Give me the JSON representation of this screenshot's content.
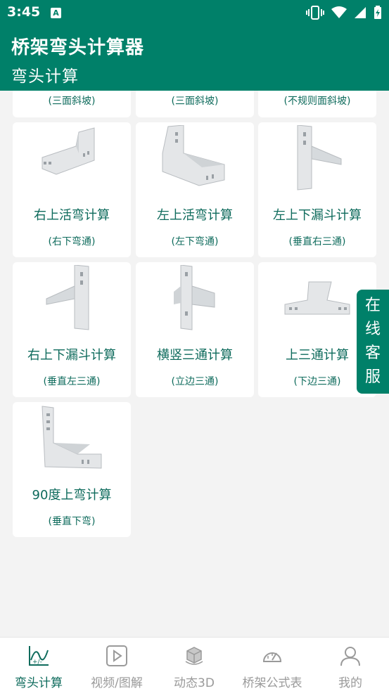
{
  "status": {
    "time": "3:45",
    "a_badge": "A"
  },
  "appbar": {
    "title": "桥架弯头计算器",
    "subtitle": "弯头计算"
  },
  "top_cards": [
    {
      "sub": "(三面斜坡)"
    },
    {
      "sub": "(三面斜坡)"
    },
    {
      "sub": "(不规则面斜坡)"
    }
  ],
  "cards": [
    {
      "title": "右上活弯计算",
      "sub": "(右下弯通)",
      "icon": "right-up-bend-image"
    },
    {
      "title": "左上活弯计算",
      "sub": "(左下弯通)",
      "icon": "left-up-bend-image"
    },
    {
      "title": "左上下漏斗计算",
      "sub": "(垂直右三通)",
      "icon": "left-funnel-image"
    },
    {
      "title": "右上下漏斗计算",
      "sub": "(垂直左三通)",
      "icon": "right-funnel-image"
    },
    {
      "title": "横竖三通计算",
      "sub": "(立边三通)",
      "icon": "vertical-tee-image"
    },
    {
      "title": "上三通计算",
      "sub": "(下边三通)",
      "icon": "upper-tee-image"
    },
    {
      "title": "90度上弯计算",
      "sub": "(垂直下弯)",
      "icon": "ninety-bend-image"
    }
  ],
  "online_service": {
    "chars": [
      "在",
      "线",
      "客",
      "服"
    ]
  },
  "nav": [
    {
      "label": "弯头计算",
      "icon": "calc-chart-icon",
      "active": true
    },
    {
      "label": "视频/图解",
      "icon": "video-icon",
      "active": false
    },
    {
      "label": "动态3D",
      "icon": "cube-3d-icon",
      "active": false
    },
    {
      "label": "桥架公式表",
      "icon": "gauge-icon",
      "active": false
    },
    {
      "label": "我的",
      "icon": "user-icon",
      "active": false
    }
  ],
  "colors": {
    "primary": "#008069",
    "text_accent": "#0e6b5c",
    "inactive": "#9a9a9a"
  }
}
